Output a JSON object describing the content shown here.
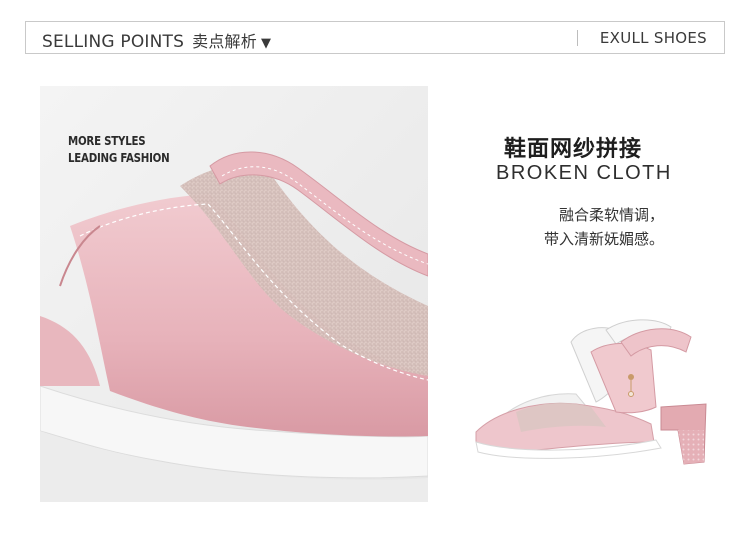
{
  "header": {
    "title_en": "SELLING POINTS",
    "title_cn": "卖点解析",
    "arrow": "▼",
    "brand": "EXULL SHOES"
  },
  "photo": {
    "caption_line1": "MORE STYLES",
    "caption_line2": "LEADING FASHION"
  },
  "feature": {
    "title_cn": "鞋面网纱拼接",
    "title_en": "BROKEN CLOTH",
    "desc_line1": "融合柔软情调，",
    "desc_line2": "带入清新妩媚感。"
  },
  "colors": {
    "leather_pink": "#e9b8bf",
    "mesh": "#ddc7c2",
    "heel_pink": "#e0a4ab",
    "border": "#c9c9c9"
  }
}
